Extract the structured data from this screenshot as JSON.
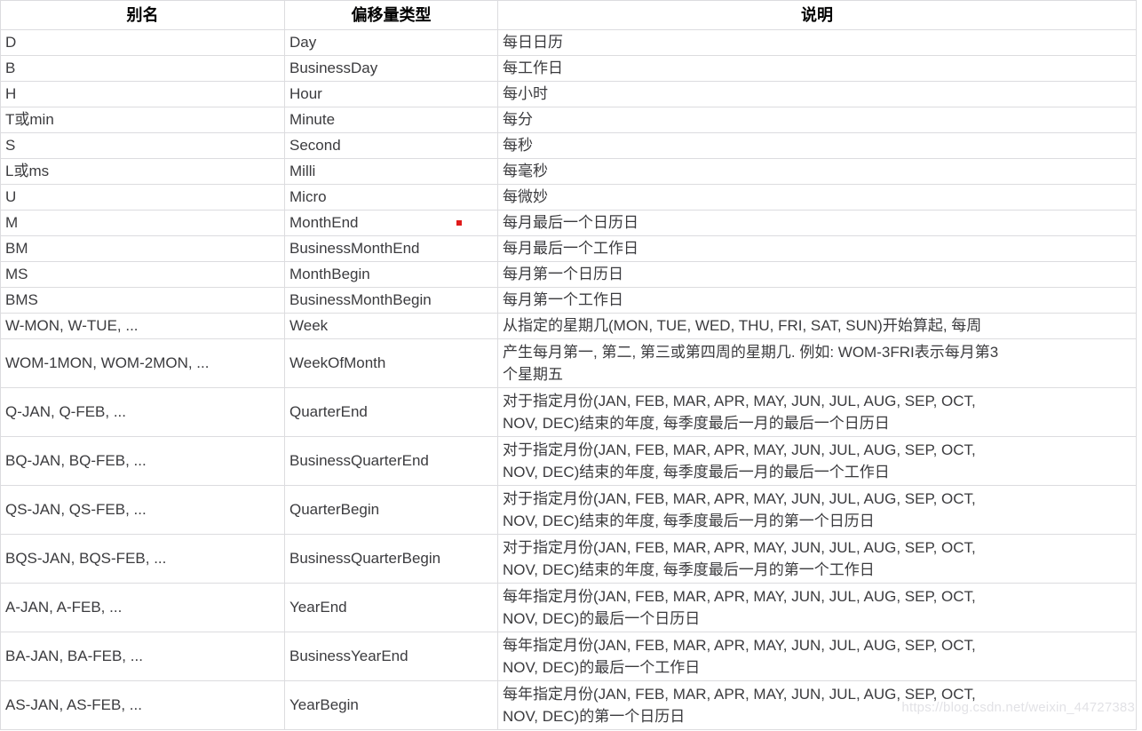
{
  "table": {
    "headers": {
      "alias": "别名",
      "type": "偏移量类型",
      "desc": "说明"
    },
    "rows": [
      {
        "alias": "D",
        "type": "Day",
        "desc_lines": [
          "每日日历"
        ]
      },
      {
        "alias": "B",
        "type": "BusinessDay",
        "desc_lines": [
          "每工作日"
        ]
      },
      {
        "alias": "H",
        "type": "Hour",
        "desc_lines": [
          "每小时"
        ]
      },
      {
        "alias": "T或min",
        "type": "Minute",
        "desc_lines": [
          "每分"
        ]
      },
      {
        "alias": "S",
        "type": "Second",
        "desc_lines": [
          "每秒"
        ]
      },
      {
        "alias": "L或ms",
        "type": "Milli",
        "desc_lines": [
          "每毫秒"
        ]
      },
      {
        "alias": "U",
        "type": "Micro",
        "desc_lines": [
          "每微妙"
        ]
      },
      {
        "alias": "M",
        "type": "MonthEnd",
        "marker": "red-dot",
        "desc_lines": [
          "每月最后一个日历日"
        ]
      },
      {
        "alias": "BM",
        "type": "BusinessMonthEnd",
        "desc_lines": [
          "每月最后一个工作日"
        ]
      },
      {
        "alias": "MS",
        "type": "MonthBegin",
        "desc_lines": [
          "每月第一个日历日"
        ]
      },
      {
        "alias": "BMS",
        "type": "BusinessMonthBegin",
        "desc_lines": [
          "每月第一个工作日"
        ]
      },
      {
        "alias": "W-MON, W-TUE, ...",
        "type": "Week",
        "desc_lines": [
          "从指定的星期几(MON, TUE, WED, THU, FRI, SAT, SUN)开始算起, 每周"
        ]
      },
      {
        "alias": "WOM-1MON, WOM-2MON, ...",
        "type": "WeekOfMonth",
        "desc_lines": [
          "产生每月第一, 第二, 第三或第四周的星期几. 例如: WOM-3FRI表示每月第3",
          "个星期五"
        ]
      },
      {
        "alias": "Q-JAN, Q-FEB, ...",
        "type": "QuarterEnd",
        "desc_lines": [
          "对于指定月份(JAN, FEB, MAR, APR, MAY, JUN, JUL, AUG, SEP, OCT,",
          "NOV, DEC)结束的年度, 每季度最后一月的最后一个日历日"
        ]
      },
      {
        "alias": "BQ-JAN, BQ-FEB, ...",
        "type": "BusinessQuarterEnd",
        "desc_lines": [
          "对于指定月份(JAN, FEB, MAR, APR, MAY, JUN, JUL, AUG, SEP, OCT,",
          "NOV, DEC)结束的年度, 每季度最后一月的最后一个工作日"
        ]
      },
      {
        "alias": "QS-JAN, QS-FEB, ...",
        "type": "QuarterBegin",
        "desc_lines": [
          "对于指定月份(JAN, FEB, MAR, APR, MAY, JUN, JUL, AUG, SEP, OCT,",
          "NOV, DEC)结束的年度, 每季度最后一月的第一个日历日"
        ]
      },
      {
        "alias": "BQS-JAN, BQS-FEB, ...",
        "type": "BusinessQuarterBegin",
        "desc_lines": [
          "对于指定月份(JAN, FEB, MAR, APR, MAY, JUN, JUL, AUG, SEP, OCT,",
          "NOV, DEC)结束的年度, 每季度最后一月的第一个工作日"
        ]
      },
      {
        "alias": "A-JAN, A-FEB, ...",
        "type": "YearEnd",
        "desc_lines": [
          "每年指定月份(JAN, FEB, MAR, APR, MAY, JUN, JUL, AUG, SEP, OCT,",
          "NOV, DEC)的最后一个日历日"
        ]
      },
      {
        "alias": "BA-JAN, BA-FEB, ...",
        "type": "BusinessYearEnd",
        "desc_lines": [
          "每年指定月份(JAN, FEB, MAR, APR, MAY, JUN, JUL, AUG, SEP, OCT,",
          "NOV, DEC)的最后一个工作日"
        ]
      },
      {
        "alias": "AS-JAN, AS-FEB, ...",
        "type": "YearBegin",
        "desc_lines": [
          "每年指定月份(JAN, FEB, MAR, APR, MAY, JUN, JUL, AUG, SEP, OCT,",
          "NOV, DEC)的第一个日历日"
        ]
      }
    ]
  },
  "watermark": {
    "text": "https://blog.csdn.net/weixin_44727383"
  },
  "colors": {
    "border": "#dcdcdf",
    "header_text": "#000000",
    "cell_text": "#3b3b3e",
    "marker_red": "#e01b1b",
    "watermark_text": "#e2e2e6",
    "background": "#ffffff"
  }
}
